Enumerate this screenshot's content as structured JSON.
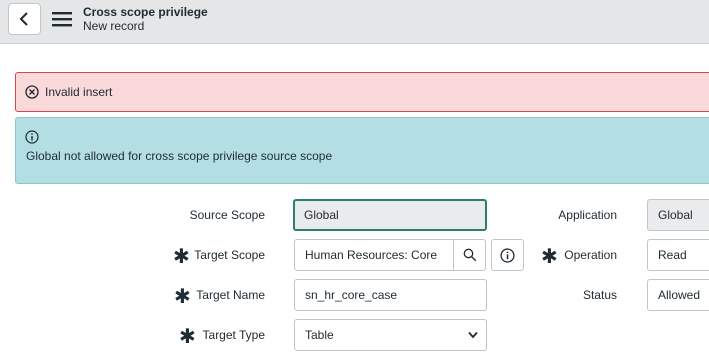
{
  "header": {
    "title": "Cross scope privilege",
    "subtitle": "New record"
  },
  "alerts": {
    "error": "Invalid insert",
    "info": "Global not allowed for cross scope privilege source scope"
  },
  "form": {
    "source_scope": {
      "label": "Source Scope",
      "value": "Global"
    },
    "target_scope": {
      "label": "Target Scope",
      "value": "Human Resources: Core"
    },
    "target_name": {
      "label": "Target Name",
      "value": "sn_hr_core_case"
    },
    "target_type": {
      "label": "Target Type",
      "value": "Table"
    },
    "application": {
      "label": "Application",
      "value": "Global"
    },
    "operation": {
      "label": "Operation",
      "value": "Read"
    },
    "status": {
      "label": "Status",
      "value": "Allowed"
    }
  },
  "icons": {
    "back": "chevron-left-icon",
    "menu": "hamburger-menu-icon",
    "error": "close-circle-icon",
    "info": "info-circle-icon",
    "search": "search-icon",
    "reference_info": "info-circle-icon",
    "dropdown": "chevron-down-icon"
  },
  "colors": {
    "header_bg": "#e4e6e7",
    "error_bg": "#f9d9da",
    "error_border": "#d64550",
    "info_bg": "#b3dfe4",
    "focus_border": "#2b7f6d"
  }
}
